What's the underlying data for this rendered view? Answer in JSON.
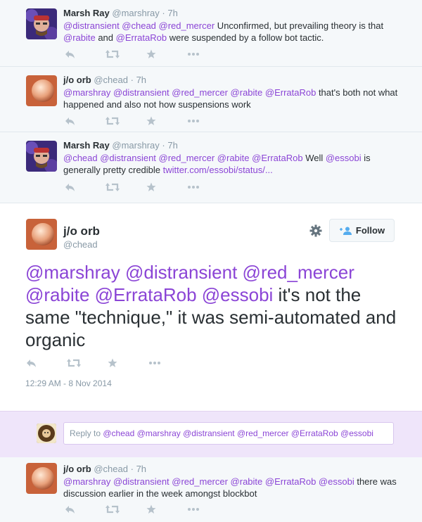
{
  "tweets": [
    {
      "name": "Marsh Ray",
      "handle": "@marshray",
      "time": "7h",
      "mentions": "@distransient @chead @red_mercer",
      "text1": " Unconfirmed, but prevailing theory is that",
      "m2": "@rabite",
      "t2": " and ",
      "m3": "@ErrataRob",
      "t3": " were suspended by a follow bot tactic."
    },
    {
      "name": "j/o orb",
      "handle": "@chead",
      "time": "7h",
      "mentions": "@marshray @distransient @red_mercer @rabite @ErrataRob",
      "text1": " that's both not what happened and also not how suspensions work"
    },
    {
      "name": "Marsh Ray",
      "handle": "@marshray",
      "time": "7h",
      "mentions": "@chead @distransient @red_mercer @rabite @ErrataRob",
      "text1": " Well ",
      "m2": "@essobi",
      "t2": " is generally pretty credible ",
      "link": "twitter.com/essobi/status/..."
    }
  ],
  "main": {
    "name": "j/o orb",
    "handle": "@chead",
    "follow_label": "Follow",
    "mentions": "@marshray @distransient @red_mercer @rabite @ErrataRob @essobi",
    "text": " it's not the same \"technique,\" it was semi-automated and organic",
    "timestamp": "12:29 AM - 8 Nov 2014"
  },
  "reply": {
    "prefix": "Reply to ",
    "mentions": "@chead @marshray @distransient @red_mercer @ErrataRob @essobi"
  },
  "bottom": {
    "name": "j/o orb",
    "handle": "@chead",
    "time": "7h",
    "mentions": "@marshray @distransient @red_mercer @rabite @ErrataRob @essobi",
    "text": " there was discussion earlier in the week amongst blockbot"
  },
  "colors": {
    "link": "#8b45d6",
    "muted": "#8899a6",
    "reply_bg": "#efe5fa"
  },
  "icons": [
    "reply-icon",
    "retweet-icon",
    "favorite-icon",
    "more-icon",
    "gear-icon",
    "add-user-icon"
  ]
}
